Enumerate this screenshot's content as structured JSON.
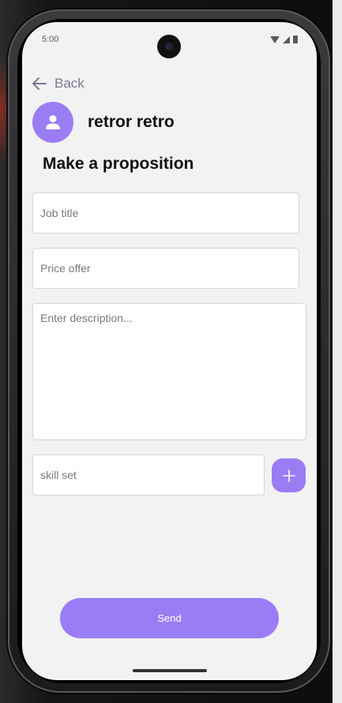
{
  "status_bar": {
    "time": "5:00"
  },
  "header": {
    "back_label": "Back",
    "user_name": "retror retro"
  },
  "form": {
    "title": "Make a proposition",
    "job_title": {
      "placeholder": "Job title",
      "value": ""
    },
    "price_offer": {
      "placeholder": "Price offer",
      "value": ""
    },
    "description": {
      "placeholder": "Enter description...",
      "value": ""
    },
    "skill_set": {
      "placeholder": "skill set",
      "value": ""
    },
    "add_skill_icon": "plus-icon",
    "send_label": "Send"
  },
  "colors": {
    "accent": "#9a7df4",
    "background": "#f2f2f2"
  }
}
